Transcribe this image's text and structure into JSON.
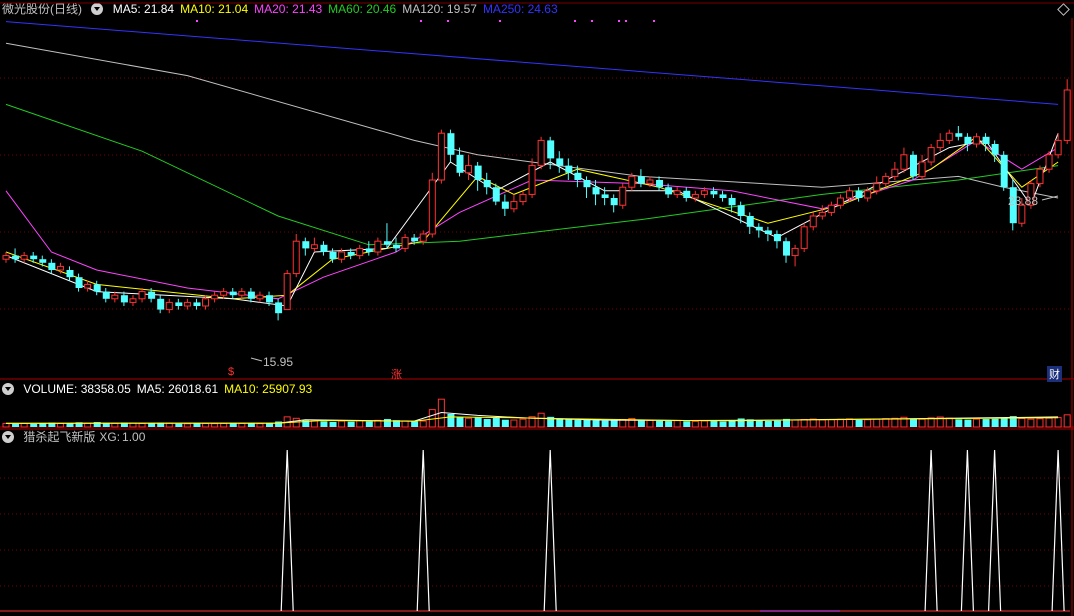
{
  "stock": {
    "name": "微光股份",
    "period": "(日线)"
  },
  "ma_legend": [
    {
      "label": "MA5:",
      "value": "21.84",
      "color": "#ffffff"
    },
    {
      "label": "MA10:",
      "value": "21.04",
      "color": "#ffff00"
    },
    {
      "label": "MA20:",
      "value": "21.43",
      "color": "#ff44ff"
    },
    {
      "label": "MA60:",
      "value": "20.46",
      "color": "#22cc22"
    },
    {
      "label": "MA120:",
      "value": "19.57",
      "color": "#c0c0c0"
    },
    {
      "label": "MA250:",
      "value": "24.63",
      "color": "#3333ff"
    }
  ],
  "price_labels": {
    "high": "23.88",
    "low": "15.95"
  },
  "markers": {
    "left": "$",
    "mid": "涨",
    "right": "财"
  },
  "volume_legend": [
    {
      "label": "VOLUME:",
      "value": "38358.05",
      "color": "#ffffff"
    },
    {
      "label": "MA5:",
      "value": "26018.61",
      "color": "#ffffff"
    },
    {
      "label": "MA10:",
      "value": "25907.93",
      "color": "#ffff00"
    }
  ],
  "indicator_legend": {
    "name": "猎杀起飞新版",
    "label": "XG:",
    "value": "1.00"
  },
  "colors": {
    "up": "#ff3232",
    "down": "#54ffff",
    "grid": "#7a0000",
    "ma250": "#3333ff",
    "ma120": "#c0c0c0",
    "ma60": "#22cc22",
    "ma20": "#ff44ff",
    "ma10": "#ffff00",
    "ma5": "#ffffff"
  },
  "chart_data": {
    "type": "candlestick",
    "y_range": [
      15.5,
      25.0
    ],
    "candles": [
      [
        18.3,
        18.4,
        18.5,
        18.2
      ],
      [
        18.4,
        18.3,
        18.6,
        18.2
      ],
      [
        18.3,
        18.4,
        18.5,
        18.2
      ],
      [
        18.4,
        18.3,
        18.5,
        18.2
      ],
      [
        18.3,
        18.2,
        18.4,
        18.1
      ],
      [
        18.2,
        18.0,
        18.3,
        17.9
      ],
      [
        18.0,
        18.1,
        18.2,
        17.9
      ],
      [
        18.0,
        17.8,
        18.1,
        17.7
      ],
      [
        17.8,
        17.5,
        17.9,
        17.4
      ],
      [
        17.5,
        17.6,
        17.7,
        17.4
      ],
      [
        17.6,
        17.4,
        17.7,
        17.3
      ],
      [
        17.4,
        17.2,
        17.5,
        17.1
      ],
      [
        17.2,
        17.3,
        17.4,
        17.1
      ],
      [
        17.3,
        17.1,
        17.4,
        17.0
      ],
      [
        17.1,
        17.2,
        17.3,
        17.0
      ],
      [
        17.2,
        17.4,
        17.5,
        17.1
      ],
      [
        17.4,
        17.2,
        17.5,
        17.1
      ],
      [
        17.2,
        16.9,
        17.3,
        16.8
      ],
      [
        16.9,
        17.1,
        17.2,
        16.8
      ],
      [
        17.1,
        17.0,
        17.2,
        16.9
      ],
      [
        17.0,
        17.1,
        17.2,
        16.9
      ],
      [
        17.1,
        17.0,
        17.2,
        16.9
      ],
      [
        17.0,
        17.2,
        17.3,
        16.9
      ],
      [
        17.2,
        17.3,
        17.4,
        17.1
      ],
      [
        17.3,
        17.4,
        17.5,
        17.2
      ],
      [
        17.4,
        17.3,
        17.5,
        17.2
      ],
      [
        17.3,
        17.4,
        17.5,
        17.2
      ],
      [
        17.4,
        17.2,
        17.5,
        17.1
      ],
      [
        17.2,
        17.3,
        17.4,
        17.1
      ],
      [
        17.3,
        17.1,
        17.4,
        17.0
      ],
      [
        17.1,
        16.8,
        17.2,
        16.6
      ],
      [
        16.9,
        17.9,
        18.0,
        16.9
      ],
      [
        17.9,
        18.8,
        19.0,
        17.8
      ],
      [
        18.8,
        18.6,
        18.9,
        18.4
      ],
      [
        18.6,
        18.7,
        18.9,
        18.5
      ],
      [
        18.7,
        18.5,
        18.8,
        18.4
      ],
      [
        18.5,
        18.3,
        18.6,
        18.2
      ],
      [
        18.3,
        18.5,
        18.6,
        18.2
      ],
      [
        18.5,
        18.4,
        18.6,
        18.3
      ],
      [
        18.4,
        18.6,
        18.7,
        18.3
      ],
      [
        18.6,
        18.5,
        18.8,
        18.4
      ],
      [
        18.5,
        18.8,
        18.9,
        18.4
      ],
      [
        18.8,
        18.7,
        19.3,
        18.6
      ],
      [
        18.7,
        18.6,
        18.9,
        18.5
      ],
      [
        18.6,
        18.9,
        19.0,
        18.5
      ],
      [
        18.9,
        18.8,
        19.0,
        18.7
      ],
      [
        18.8,
        19.0,
        19.1,
        18.7
      ],
      [
        19.0,
        20.5,
        20.7,
        18.9
      ],
      [
        20.5,
        21.8,
        21.9,
        20.4
      ],
      [
        21.8,
        21.2,
        21.9,
        21.0
      ],
      [
        21.2,
        20.7,
        21.4,
        20.6
      ],
      [
        20.7,
        20.9,
        21.2,
        20.5
      ],
      [
        20.9,
        20.5,
        21.0,
        20.2
      ],
      [
        20.5,
        20.3,
        20.7,
        20.1
      ],
      [
        20.3,
        19.9,
        20.4,
        19.8
      ],
      [
        19.9,
        19.7,
        20.1,
        19.5
      ],
      [
        19.7,
        19.9,
        20.1,
        19.6
      ],
      [
        19.9,
        20.1,
        20.2,
        19.8
      ],
      [
        20.1,
        20.9,
        21.1,
        20.0
      ],
      [
        20.9,
        21.6,
        21.7,
        20.8
      ],
      [
        21.6,
        21.1,
        21.7,
        20.8
      ],
      [
        21.1,
        20.9,
        21.3,
        20.7
      ],
      [
        20.9,
        20.7,
        21.1,
        20.5
      ],
      [
        20.7,
        20.5,
        20.9,
        20.3
      ],
      [
        20.5,
        20.3,
        20.6,
        20.0
      ],
      [
        20.3,
        20.1,
        20.5,
        19.8
      ],
      [
        20.1,
        20.0,
        20.3,
        19.8
      ],
      [
        20.0,
        19.8,
        20.1,
        19.6
      ],
      [
        19.8,
        20.3,
        20.4,
        19.7
      ],
      [
        20.3,
        20.6,
        20.7,
        20.2
      ],
      [
        20.6,
        20.4,
        20.8,
        20.3
      ],
      [
        20.4,
        20.5,
        20.6,
        20.3
      ],
      [
        20.5,
        20.3,
        20.6,
        20.2
      ],
      [
        20.3,
        20.1,
        20.4,
        20.0
      ],
      [
        20.1,
        20.2,
        20.3,
        20.0
      ],
      [
        20.2,
        20.0,
        20.3,
        19.9
      ],
      [
        20.0,
        20.1,
        20.2,
        19.9
      ],
      [
        20.1,
        20.2,
        20.3,
        20.0
      ],
      [
        20.2,
        20.1,
        20.3,
        20.0
      ],
      [
        20.1,
        20.0,
        20.2,
        19.9
      ],
      [
        20.0,
        19.8,
        20.1,
        19.6
      ],
      [
        19.8,
        19.5,
        19.9,
        19.3
      ],
      [
        19.5,
        19.2,
        19.6,
        19.0
      ],
      [
        19.2,
        19.1,
        19.3,
        18.9
      ],
      [
        19.1,
        19.0,
        19.2,
        18.8
      ],
      [
        19.0,
        18.8,
        19.1,
        18.6
      ],
      [
        18.8,
        18.4,
        18.9,
        18.2
      ],
      [
        18.4,
        18.6,
        18.7,
        18.1
      ],
      [
        18.6,
        19.2,
        19.3,
        18.5
      ],
      [
        19.2,
        19.5,
        19.6,
        19.1
      ],
      [
        19.5,
        19.6,
        19.8,
        19.4
      ],
      [
        19.6,
        19.8,
        19.9,
        19.5
      ],
      [
        19.8,
        20.0,
        20.1,
        19.7
      ],
      [
        20.0,
        20.2,
        20.3,
        19.9
      ],
      [
        20.2,
        20.0,
        20.3,
        19.9
      ],
      [
        20.0,
        20.2,
        20.3,
        19.9
      ],
      [
        20.2,
        20.4,
        20.6,
        20.1
      ],
      [
        20.4,
        20.6,
        20.7,
        20.3
      ],
      [
        20.6,
        20.8,
        21.0,
        20.5
      ],
      [
        20.8,
        21.2,
        21.4,
        20.7
      ],
      [
        21.2,
        20.6,
        21.3,
        20.5
      ],
      [
        20.6,
        21.0,
        21.2,
        20.5
      ],
      [
        21.0,
        21.4,
        21.5,
        20.9
      ],
      [
        21.4,
        21.6,
        21.8,
        21.3
      ],
      [
        21.6,
        21.8,
        21.9,
        21.5
      ],
      [
        21.8,
        21.7,
        22.0,
        21.6
      ],
      [
        21.7,
        21.5,
        21.8,
        21.3
      ],
      [
        21.5,
        21.7,
        21.8,
        21.4
      ],
      [
        21.7,
        21.5,
        21.8,
        21.3
      ],
      [
        21.5,
        21.2,
        21.6,
        21.0
      ],
      [
        21.2,
        20.3,
        21.3,
        20.2
      ],
      [
        20.3,
        19.3,
        20.5,
        19.1
      ],
      [
        19.3,
        19.8,
        20.0,
        19.2
      ],
      [
        19.8,
        20.4,
        20.5,
        19.7
      ],
      [
        20.4,
        20.8,
        20.9,
        20.3
      ],
      [
        20.8,
        21.2,
        21.3,
        20.7
      ],
      [
        21.2,
        21.6,
        21.8,
        21.1
      ],
      [
        21.6,
        23.0,
        23.3,
        21.5
      ]
    ],
    "ma250": [
      [
        0,
        24.9
      ],
      [
        116,
        22.6
      ]
    ],
    "ma120": [
      [
        0,
        24.3
      ],
      [
        20,
        23.4
      ],
      [
        45,
        21.6
      ],
      [
        52,
        21.2
      ],
      [
        70,
        20.6
      ],
      [
        90,
        20.3
      ],
      [
        105,
        20.6
      ],
      [
        110,
        20.3
      ],
      [
        116,
        20.0
      ]
    ],
    "ma60": [
      [
        0,
        22.6
      ],
      [
        15,
        21.3
      ],
      [
        30,
        19.5
      ],
      [
        40,
        18.7
      ],
      [
        50,
        18.8
      ],
      [
        70,
        19.4
      ],
      [
        90,
        20.1
      ],
      [
        105,
        20.5
      ],
      [
        116,
        20.9
      ]
    ],
    "ma20": [
      [
        0,
        20.2
      ],
      [
        5,
        18.5
      ],
      [
        10,
        18.0
      ],
      [
        20,
        17.5
      ],
      [
        30,
        17.2
      ],
      [
        35,
        17.8
      ],
      [
        43,
        18.5
      ],
      [
        50,
        19.6
      ],
      [
        58,
        20.5
      ],
      [
        70,
        20.4
      ],
      [
        80,
        20.2
      ],
      [
        90,
        19.7
      ],
      [
        100,
        20.5
      ],
      [
        107,
        21.6
      ],
      [
        112,
        20.8
      ],
      [
        116,
        21.4
      ]
    ],
    "ma10": [
      [
        0,
        18.5
      ],
      [
        10,
        17.6
      ],
      [
        25,
        17.2
      ],
      [
        31,
        17.3
      ],
      [
        36,
        18.3
      ],
      [
        46,
        18.8
      ],
      [
        52,
        20.6
      ],
      [
        56,
        20.1
      ],
      [
        63,
        20.8
      ],
      [
        72,
        20.3
      ],
      [
        84,
        19.3
      ],
      [
        92,
        19.8
      ],
      [
        102,
        20.8
      ],
      [
        107,
        21.7
      ],
      [
        112,
        20.3
      ],
      [
        116,
        21.0
      ]
    ],
    "ma5": [
      [
        0,
        18.4
      ],
      [
        10,
        17.4
      ],
      [
        25,
        17.2
      ],
      [
        31,
        17.0
      ],
      [
        34,
        18.5
      ],
      [
        42,
        18.6
      ],
      [
        49,
        21.0
      ],
      [
        54,
        20.2
      ],
      [
        60,
        21.0
      ],
      [
        66,
        20.2
      ],
      [
        74,
        20.2
      ],
      [
        85,
        18.9
      ],
      [
        94,
        20.1
      ],
      [
        104,
        21.4
      ],
      [
        108,
        21.6
      ],
      [
        113,
        19.8
      ],
      [
        116,
        21.8
      ]
    ],
    "volume_range": [
      0,
      40000
    ],
    "volume": [
      5000,
      4500,
      4800,
      4200,
      5200,
      6000,
      4800,
      5500,
      6500,
      5200,
      6800,
      5800,
      5000,
      6200,
      5400,
      4800,
      5000,
      6000,
      5200,
      4600,
      4400,
      5000,
      4800,
      4600,
      4800,
      5200,
      5000,
      5200,
      4600,
      5400,
      7600,
      14000,
      12000,
      9000,
      8500,
      7800,
      7000,
      8200,
      7400,
      8800,
      7600,
      9200,
      11000,
      9400,
      8400,
      7800,
      8200,
      24000,
      38358,
      18000,
      14000,
      12000,
      13000,
      11000,
      12400,
      10000,
      9600,
      10800,
      14200,
      19000,
      14000,
      12000,
      11000,
      9800,
      10200,
      9400,
      8800,
      9200,
      10400,
      11800,
      9600,
      9000,
      8600,
      8200,
      8800,
      8000,
      7800,
      8400,
      8200,
      7600,
      9400,
      11800,
      10600,
      9000,
      8400,
      8800,
      11200,
      9600,
      10400,
      11000,
      9800,
      10200,
      10600,
      11200,
      9800,
      10000,
      10800,
      11600,
      12000,
      13400,
      11200,
      10800,
      12600,
      13800,
      12200,
      10600,
      10200,
      10800,
      11000,
      11400,
      12600,
      15000,
      11800,
      10800,
      11400,
      12200,
      13000,
      16800
    ],
    "volume_ma5": [
      [
        0,
        5000
      ],
      [
        30,
        5200
      ],
      [
        33,
        10000
      ],
      [
        45,
        8200
      ],
      [
        48,
        20000
      ],
      [
        52,
        16000
      ],
      [
        58,
        12000
      ],
      [
        66,
        9500
      ],
      [
        80,
        8500
      ],
      [
        90,
        10400
      ],
      [
        104,
        12000
      ],
      [
        116,
        14000
      ]
    ],
    "volume_ma10": [
      [
        0,
        5200
      ],
      [
        30,
        5400
      ],
      [
        35,
        9000
      ],
      [
        45,
        8000
      ],
      [
        49,
        14000
      ],
      [
        55,
        13000
      ],
      [
        62,
        11500
      ],
      [
        75,
        9000
      ],
      [
        90,
        10000
      ],
      [
        104,
        11600
      ],
      [
        116,
        12800
      ]
    ],
    "xg_signals": [
      31,
      46,
      60,
      102,
      106,
      109,
      116
    ]
  }
}
